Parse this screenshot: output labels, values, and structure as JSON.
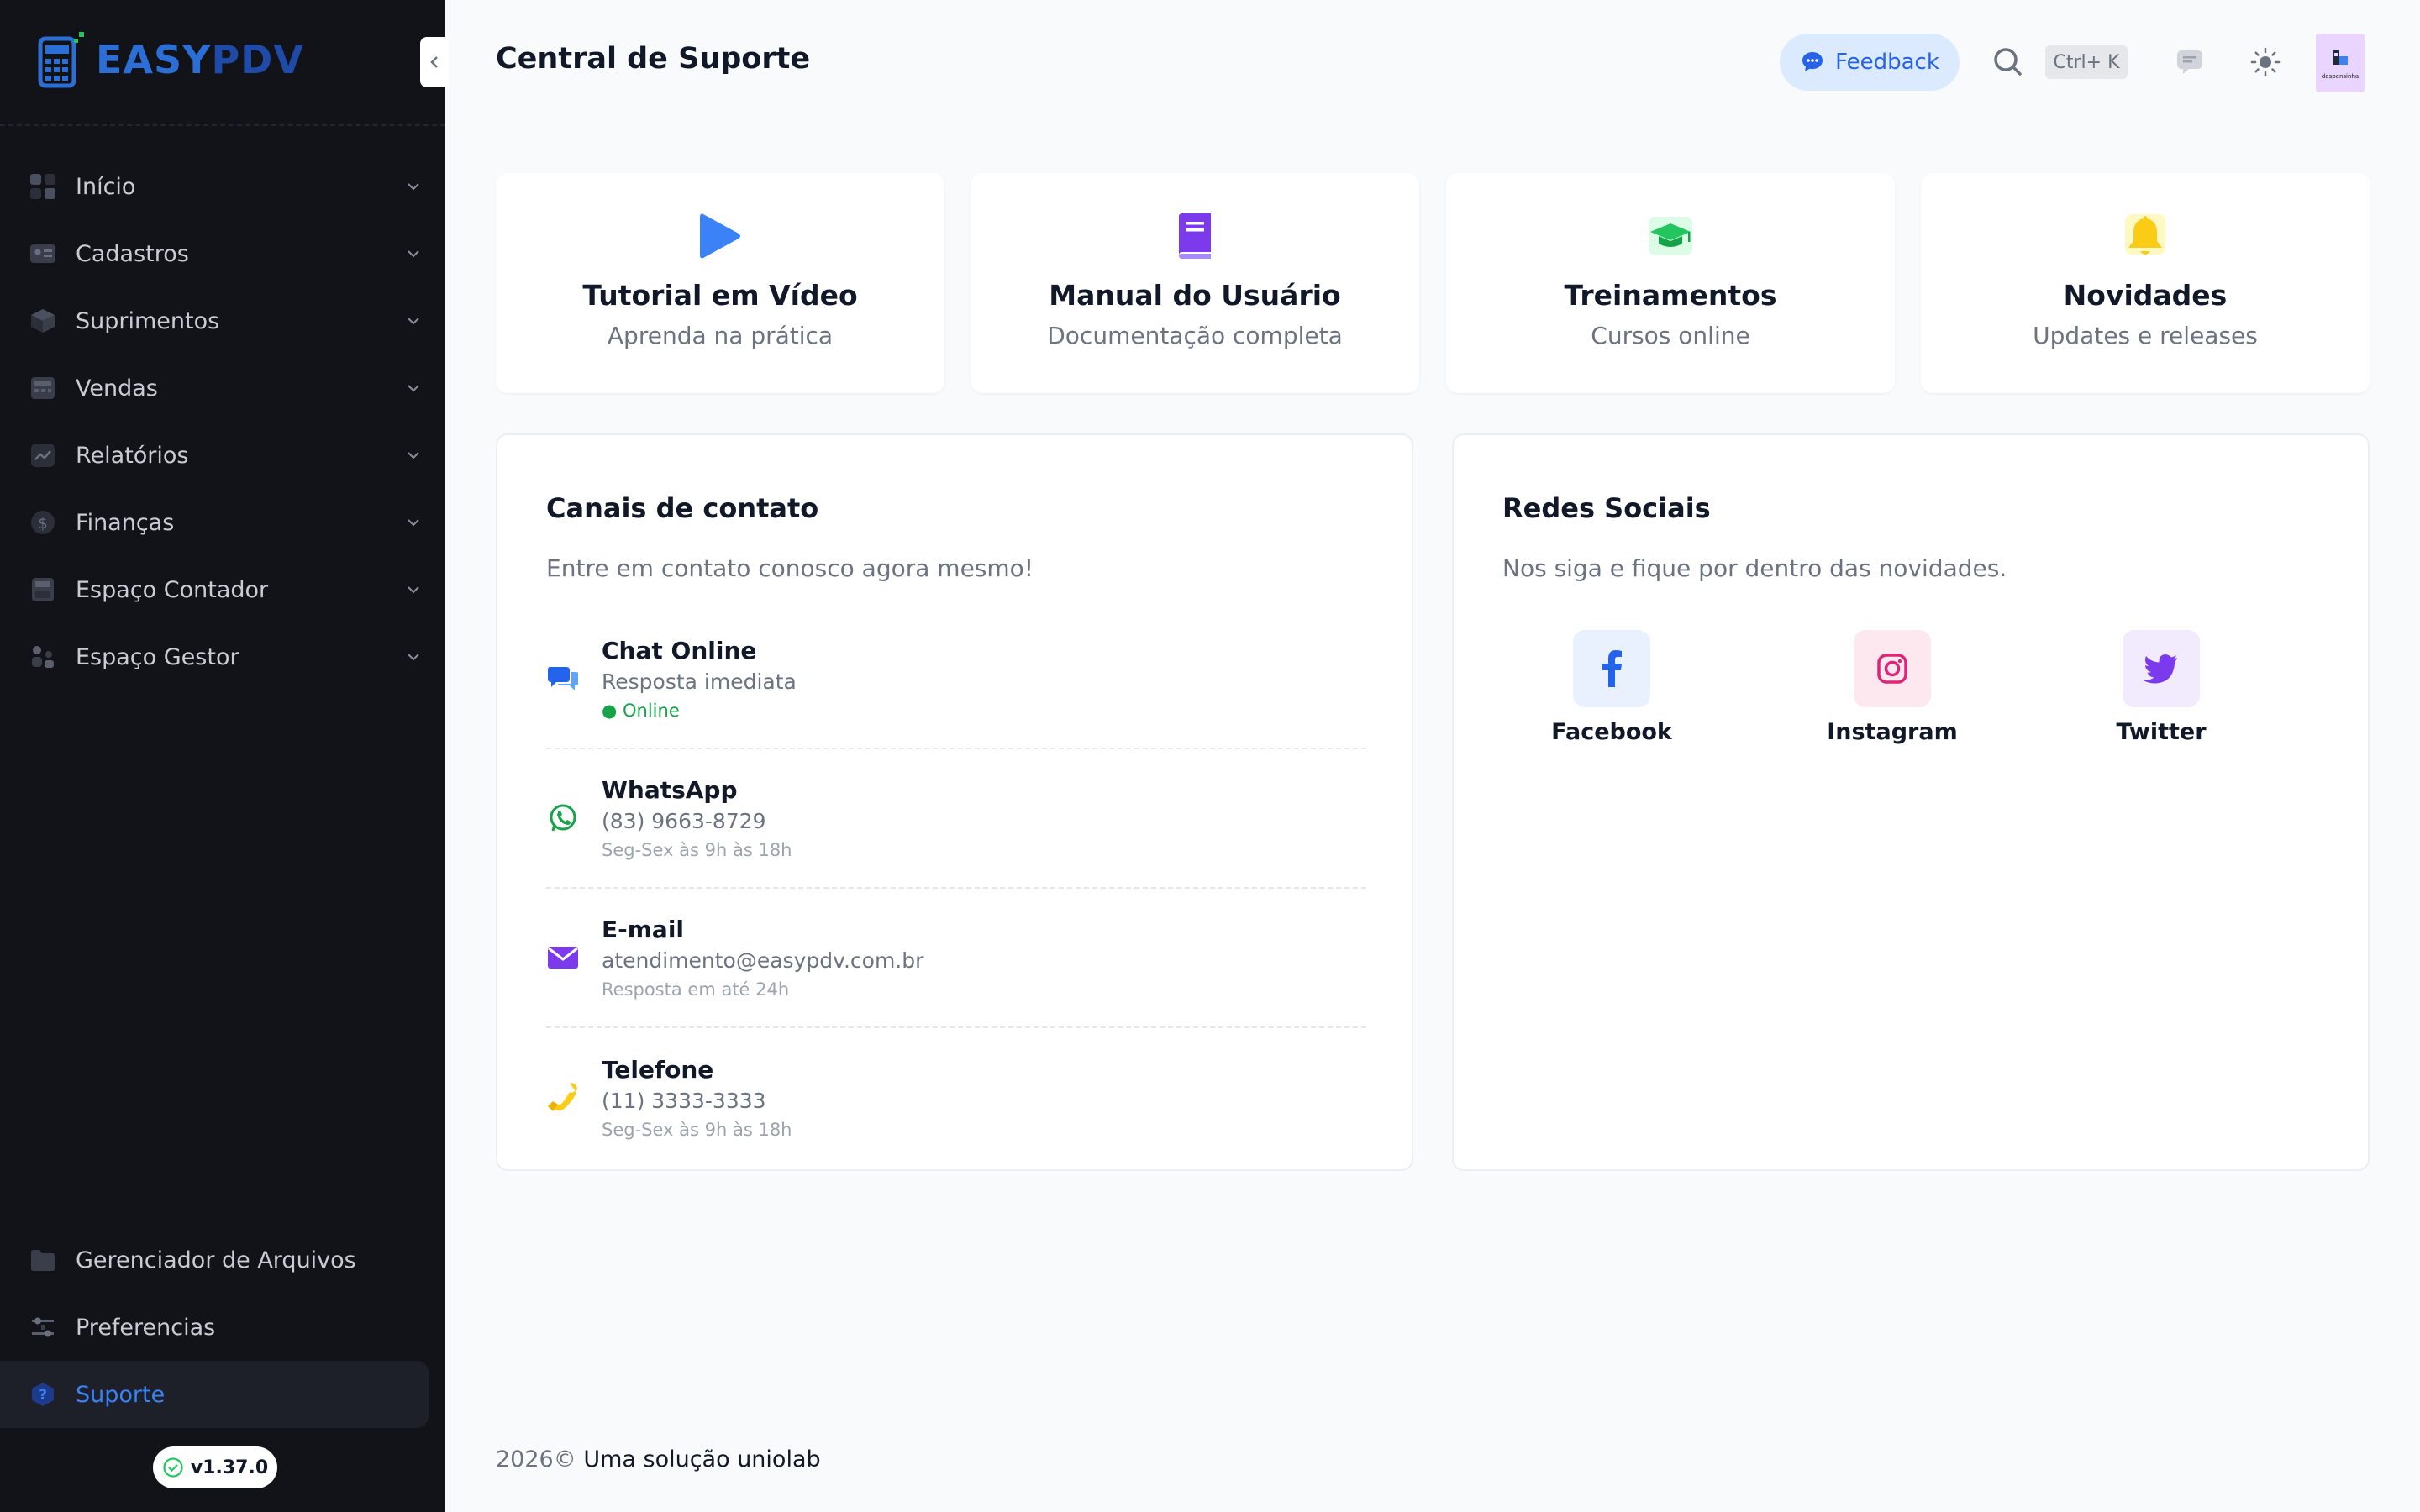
{
  "app": {
    "logo_easy": "EASY",
    "logo_pdv": "PDV",
    "version": "v1.37.0"
  },
  "sidebar": {
    "items": [
      {
        "label": "Início",
        "icon": "grid-icon"
      },
      {
        "label": "Cadastros",
        "icon": "id-card-icon"
      },
      {
        "label": "Suprimentos",
        "icon": "box-icon"
      },
      {
        "label": "Vendas",
        "icon": "register-icon"
      },
      {
        "label": "Relatórios",
        "icon": "chart-icon"
      },
      {
        "label": "Finanças",
        "icon": "dollar-icon"
      },
      {
        "label": "Espaço Contador",
        "icon": "calculator-icon"
      },
      {
        "label": "Espaço Gestor",
        "icon": "people-icon"
      }
    ],
    "bottom_items": [
      {
        "label": "Gerenciador de Arquivos",
        "icon": "folder-icon"
      },
      {
        "label": "Preferencias",
        "icon": "sliders-icon"
      },
      {
        "label": "Suporte",
        "icon": "help-icon",
        "active": true
      }
    ]
  },
  "header": {
    "title": "Central de Suporte",
    "feedback_label": "Feedback",
    "shortcut": "Ctrl+ K",
    "avatar_text": "despensinha"
  },
  "quick_cards": [
    {
      "title": "Tutorial em Vídeo",
      "subtitle": "Aprenda na prática",
      "icon": "play-icon",
      "color": "#3b82f6"
    },
    {
      "title": "Manual do Usuário",
      "subtitle": "Documentação completa",
      "icon": "book-icon",
      "color": "#7c3aed"
    },
    {
      "title": "Treinamentos",
      "subtitle": "Cursos online",
      "icon": "graduation-cap-icon",
      "color": "#22c55e"
    },
    {
      "title": "Novidades",
      "subtitle": "Updates e releases",
      "icon": "bell-icon",
      "color": "#facc15"
    }
  ],
  "contact": {
    "title": "Canais de contato",
    "subtitle": "Entre em contato conosco agora mesmo!",
    "channels": [
      {
        "name": "Chat Online",
        "detail": "Resposta imediata",
        "note": "● Online",
        "icon": "chat-bubbles-icon",
        "color": "#2563eb"
      },
      {
        "name": "WhatsApp",
        "detail": "(83) 9663-8729",
        "note": "Seg-Sex às 9h às 18h",
        "icon": "whatsapp-icon",
        "color": "#16a34a"
      },
      {
        "name": "E-mail",
        "detail": "atendimento@easypdv.com.br",
        "note": "Resposta em até 24h",
        "icon": "envelope-icon",
        "color": "#7c3aed"
      },
      {
        "name": "Telefone",
        "detail": "(11) 3333-3333",
        "note": "Seg-Sex às 9h às 18h",
        "icon": "phone-icon",
        "color": "#eab308"
      }
    ]
  },
  "social": {
    "title": "Redes Sociais",
    "subtitle": "Nos siga e fique por dentro das novidades.",
    "networks": [
      {
        "name": "Facebook",
        "icon": "facebook-icon",
        "color": "#2563eb",
        "bg": "#e8f1fd"
      },
      {
        "name": "Instagram",
        "icon": "instagram-icon",
        "color": "#db2777",
        "bg": "#fde8ef"
      },
      {
        "name": "Twitter",
        "icon": "twitter-icon",
        "color": "#7c3aed",
        "bg": "#f1ebfd"
      }
    ]
  },
  "footer": {
    "year": "2026©",
    "text": "Uma solução uniolab"
  }
}
